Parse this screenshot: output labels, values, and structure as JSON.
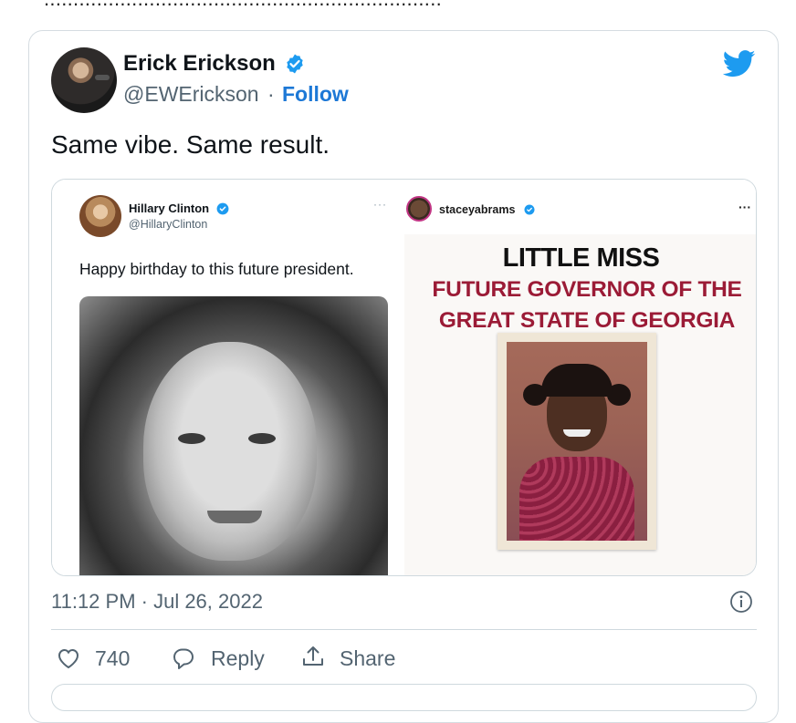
{
  "page": {
    "top_text": "...................................................................."
  },
  "tweet": {
    "author_name": "Erick Erickson",
    "author_handle": "@EWErickson",
    "separator": "·",
    "follow_label": "Follow",
    "text": "Same vibe. Same result.",
    "timestamp": "11:12 PM · Jul 26, 2022",
    "like_count": "740",
    "reply_label": "Reply",
    "share_label": "Share"
  },
  "embedded_left": {
    "name": "Hillary Clinton",
    "handle": "@HillaryClinton",
    "more": "···",
    "text": "Happy birthday to this future president."
  },
  "embedded_right": {
    "username": "staceyabrams",
    "more": "···",
    "headline": "LITTLE MISS",
    "subline_1": "FUTURE GOVERNOR OF THE",
    "subline_2": "GREAT STATE OF GEORGIA"
  },
  "colors": {
    "twitter_blue": "#1d9bf0",
    "follow_blue": "#1d78d6",
    "headline_red": "#9b1b36"
  },
  "icons": [
    "verified-badge-icon",
    "twitter-bird-icon",
    "info-icon",
    "heart-icon",
    "reply-bubble-icon",
    "share-icon"
  ]
}
